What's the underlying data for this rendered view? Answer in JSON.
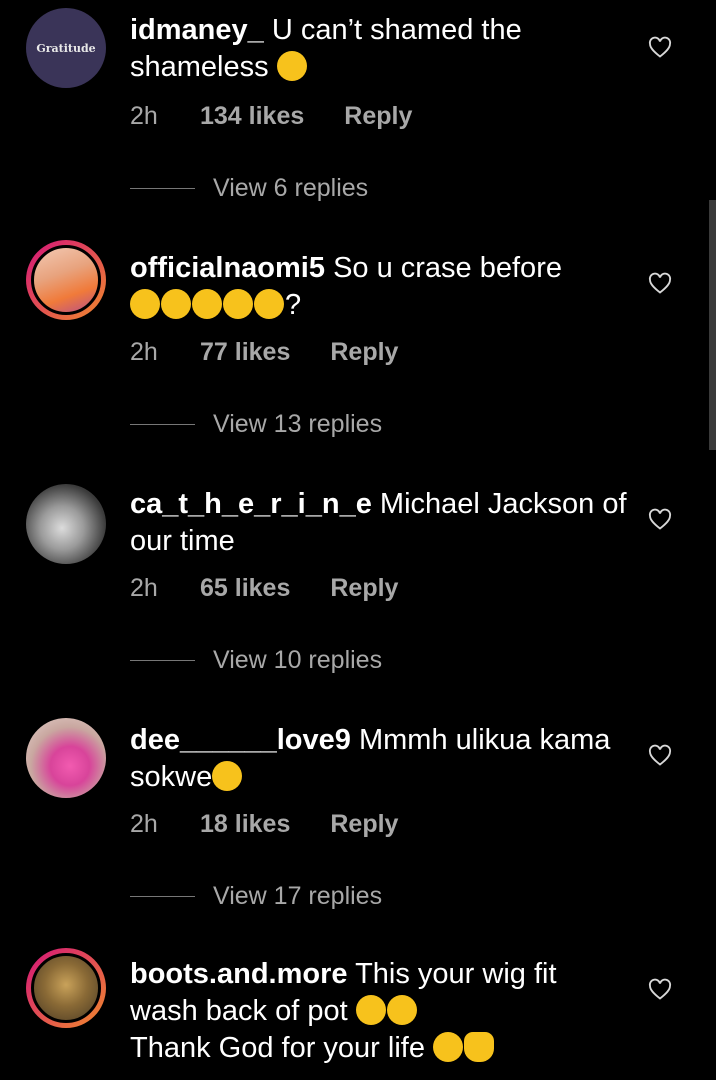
{
  "comments": [
    {
      "username": "idmaney_",
      "text": "U can’t shamed the shameless",
      "emojis_after": [
        "tears-of-joy"
      ],
      "time": "2h",
      "likes": "134 likes",
      "reply": "Reply",
      "view_replies": "View 6 replies",
      "avatar_text": "Gratitude"
    },
    {
      "username": "officialnaomi5",
      "text": "So u crase before",
      "emojis_after": [
        "thinking",
        "neutral",
        "tears-of-joy",
        "tears-of-joy",
        "tears-of-joy"
      ],
      "suffix": "?",
      "time": "2h",
      "likes": "77 likes",
      "reply": "Reply",
      "view_replies": "View 13 replies"
    },
    {
      "username": "ca_t_h_e_r_i_n_e",
      "text": "Michael Jackson of our time",
      "time": "2h",
      "likes": "65 likes",
      "reply": "Reply",
      "view_replies": "View 10 replies"
    },
    {
      "username": "dee______love9",
      "text": "Mmmh ulikua kama sokwe",
      "emojis_after": [
        "tears-of-joy"
      ],
      "time": "2h",
      "likes": "18 likes",
      "reply": "Reply",
      "view_replies": "View 17 replies"
    },
    {
      "username": "boots.and.more",
      "text": "This your wig fit wash back of pot",
      "emojis_after": [
        "tears-of-joy",
        "tears-of-joy"
      ],
      "text2": "Thank God for your life",
      "emojis_after2": [
        "tears-of-joy",
        "waving-hand"
      ]
    }
  ],
  "colors": {
    "background": "#000000",
    "secondary_text": "#a8a8a8",
    "emoji": "#f7c21c",
    "story_ring": "#e0306a"
  }
}
